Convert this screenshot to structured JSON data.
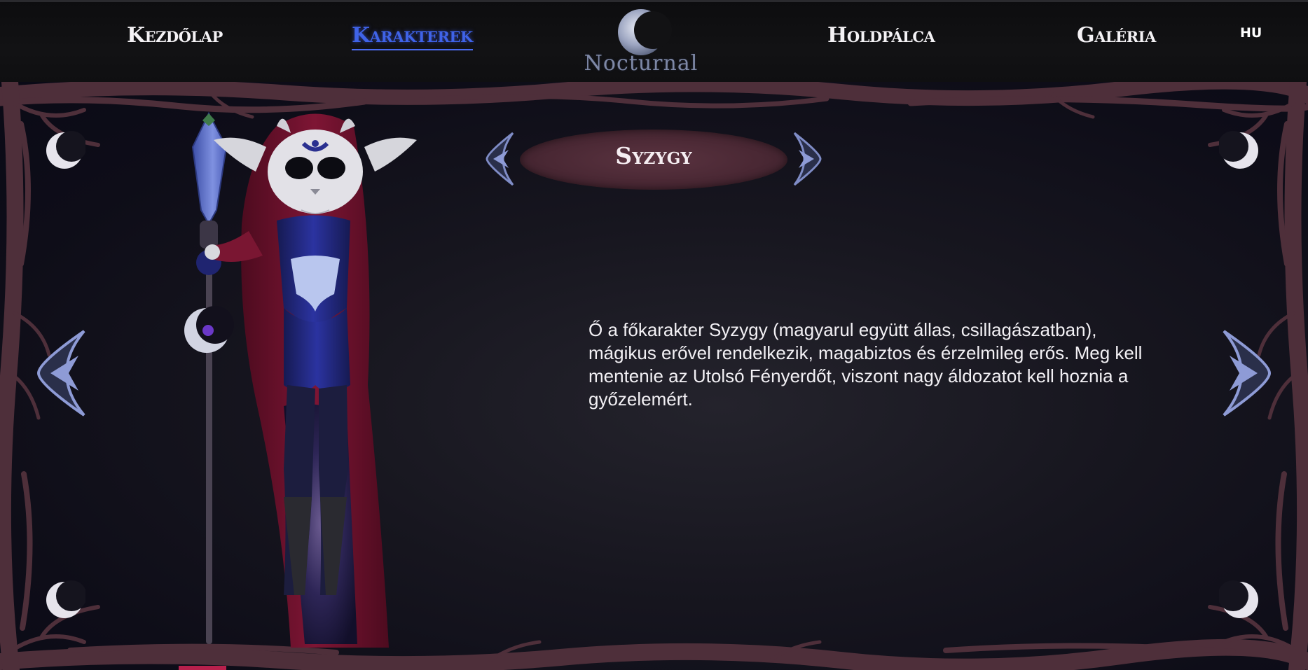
{
  "nav": {
    "home_label": "Kezdőlap",
    "characters_label": "Karakterek",
    "wand_label": "Holdpálca",
    "gallery_label": "Galéria",
    "language": "HU",
    "logo_text": "Nocturnal",
    "active_item": "characters"
  },
  "character": {
    "name": "Syzygy",
    "description": "Ő a főkarakter Syzygy (magyarul együtt állas, csillagászatban), mágikus erővel rendelkezik, magabiztos és érzelmileg erős. Meg kell mentenie az Utolsó Fényerdőt, viszont nagy áldozatot kell hoznia a győzelemért."
  },
  "icons": {
    "prev_small": "chevron-left-icon",
    "next_small": "chevron-right-icon",
    "prev_big": "chevron-left-icon",
    "next_big": "chevron-right-icon",
    "corner": "crescent-moon-icon",
    "logo": "crescent-moon-logo"
  },
  "colors": {
    "active_nav": "#3f63e8",
    "frame_branches": "#4e2f3a",
    "title_plate": "#4a2834",
    "arrow_blue": "#8e9bd6",
    "background": "#17161f"
  }
}
